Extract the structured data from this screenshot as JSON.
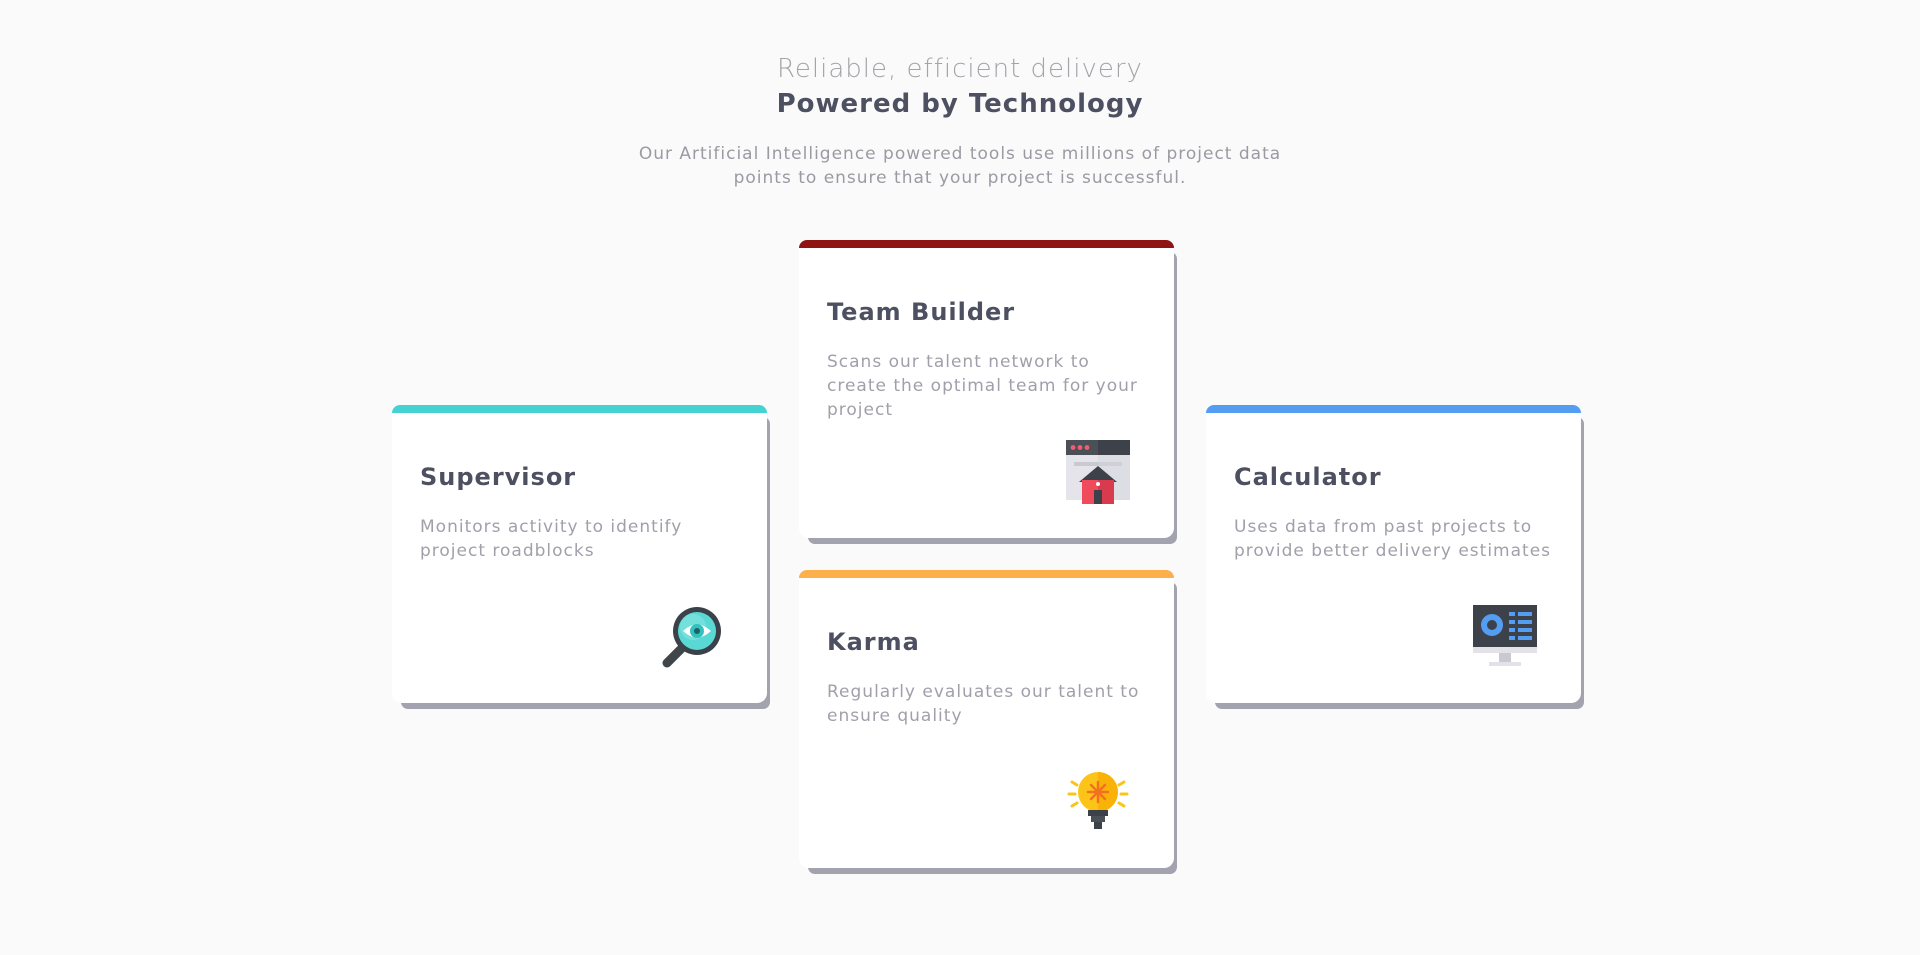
{
  "header": {
    "tagline": "Reliable, efficient delivery",
    "headline": "Powered by Technology",
    "intro": "Our Artificial Intelligence powered tools use millions of project data points to ensure that your project is successful."
  },
  "cards": {
    "supervisor": {
      "title": "Supervisor",
      "description": "Monitors activity to identify project roadblocks",
      "accent": "#44d3d2",
      "icon": "magnifier-eye-icon"
    },
    "team_builder": {
      "title": "Team Builder",
      "description": "Scans our talent network to create the optimal team for your project",
      "accent": "#8f1515",
      "icon": "browser-house-icon"
    },
    "karma": {
      "title": "Karma",
      "description": "Regularly evaluates our talent to ensure quality",
      "accent": "#fcaf4a",
      "icon": "lightbulb-icon"
    },
    "calculator": {
      "title": "Calculator",
      "description": "Uses data from past projects to provide better delivery estimates",
      "accent": "#549ef2",
      "icon": "monitor-chart-icon"
    }
  }
}
